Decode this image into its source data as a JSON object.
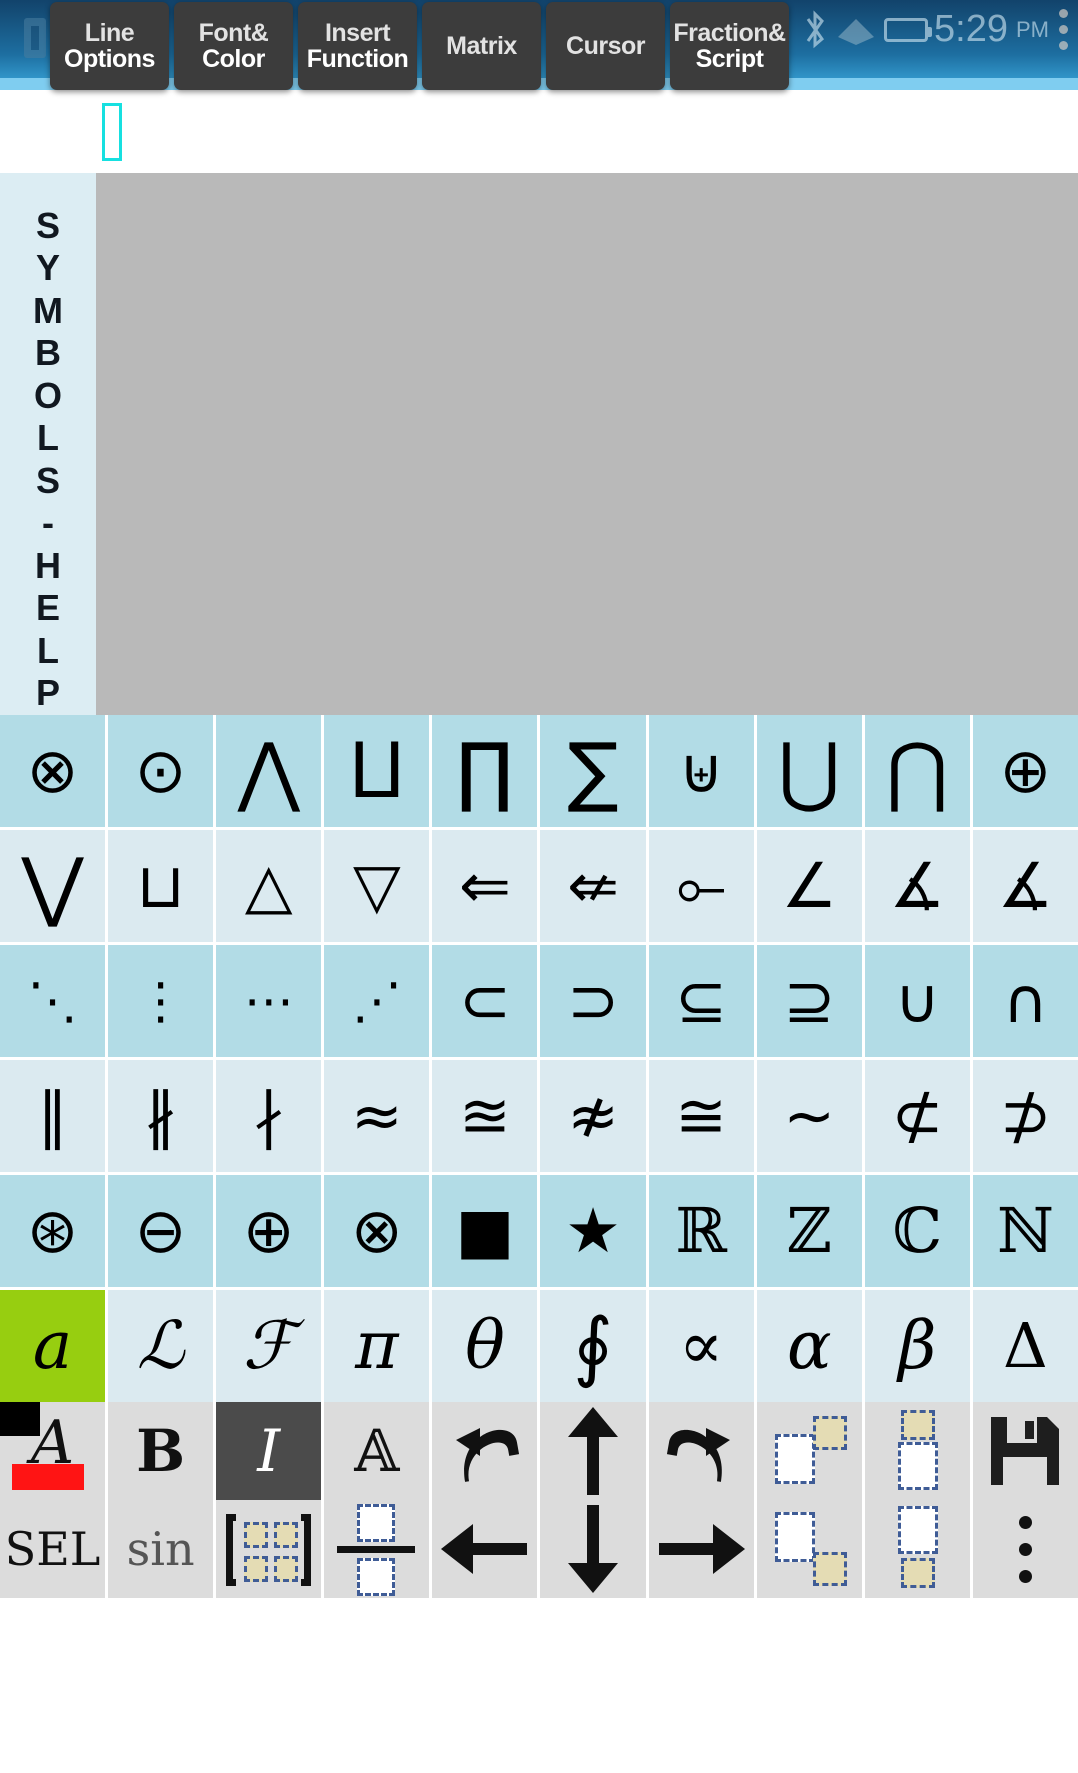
{
  "statusbar": {
    "time": "5:29",
    "ampm": "PM",
    "icons": [
      "sim-card-icon",
      "bluetooth-icon",
      "wifi-icon",
      "battery-icon",
      "overflow-menu-icon"
    ]
  },
  "toolbar": {
    "buttons": [
      {
        "name": "line-options",
        "line1": "Line",
        "line2": "Options"
      },
      {
        "name": "font-color",
        "line1": "Font&",
        "line2": "Color"
      },
      {
        "name": "insert-function",
        "line1": "Insert",
        "line2": "Function"
      },
      {
        "name": "matrix",
        "line1": "Matrix",
        "line2": ""
      },
      {
        "name": "cursor",
        "line1": "Cursor",
        "line2": ""
      },
      {
        "name": "fraction-script",
        "line1": "Fraction&",
        "line2": "Script"
      }
    ]
  },
  "editor": {
    "content": "",
    "caret_visible": true,
    "sidebar_label": "SYMBOLS-HELP",
    "sidebar_letters": [
      "S",
      "Y",
      "M",
      "B",
      "O",
      "L",
      "S",
      "-",
      "H",
      "E",
      "L",
      "P"
    ],
    "canvas_color": "#b9b9b9"
  },
  "colors": {
    "grid_dark": "#b2dce6",
    "grid_light": "#dbeaf0",
    "selected": "#97ce10",
    "toolbar_chip": "#3c3c3c",
    "accent_caret": "#16e0e0",
    "sidebar_bg": "#dcedf3",
    "bottom_key": "#dcdcdc",
    "bottom_key_active": "#4b4b4b"
  },
  "symbol_grid": {
    "columns": 10,
    "selected_index": 50,
    "rows": [
      {
        "shade": "dark",
        "cells": [
          {
            "name": "symbol-circled-times",
            "glyph": "⊗"
          },
          {
            "name": "symbol-circled-dot",
            "glyph": "⊙"
          },
          {
            "name": "symbol-logical-and",
            "glyph": "⋀"
          },
          {
            "name": "symbol-coproduct",
            "glyph": "⨿"
          },
          {
            "name": "symbol-product",
            "glyph": "∏"
          },
          {
            "name": "symbol-summation",
            "glyph": "∑"
          },
          {
            "name": "symbol-multiset-union",
            "glyph": "⊎"
          },
          {
            "name": "symbol-big-union",
            "glyph": "⋃"
          },
          {
            "name": "symbol-big-intersection",
            "glyph": "⋂"
          },
          {
            "name": "symbol-circled-plus",
            "glyph": "⊕"
          }
        ]
      },
      {
        "shade": "light",
        "cells": [
          {
            "name": "symbol-logical-or",
            "glyph": "⋁"
          },
          {
            "name": "symbol-square-cup",
            "glyph": "⊔"
          },
          {
            "name": "symbol-triangle-up",
            "glyph": "△"
          },
          {
            "name": "symbol-triangle-down",
            "glyph": "▽"
          },
          {
            "name": "symbol-leftwards-double-arrow",
            "glyph": "⇐"
          },
          {
            "name": "symbol-leftwards-double-arrow-not",
            "glyph": "⇍"
          },
          {
            "name": "symbol-multimap-left",
            "glyph": "⟜"
          },
          {
            "name": "symbol-angle",
            "glyph": "∠"
          },
          {
            "name": "symbol-measured-angle",
            "glyph": "∡"
          },
          {
            "name": "symbol-measured-angle-2",
            "glyph": "∡"
          }
        ]
      },
      {
        "shade": "dark",
        "cells": [
          {
            "name": "symbol-down-right-diagonal-ellipsis",
            "glyph": "⋱"
          },
          {
            "name": "symbol-vertical-ellipsis",
            "glyph": "⋮"
          },
          {
            "name": "symbol-midline-ellipsis",
            "glyph": "⋯"
          },
          {
            "name": "symbol-up-right-diagonal-ellipsis",
            "glyph": "⋰"
          },
          {
            "name": "symbol-subset",
            "glyph": "⊂"
          },
          {
            "name": "symbol-superset",
            "glyph": "⊃"
          },
          {
            "name": "symbol-subset-or-equal",
            "glyph": "⊆"
          },
          {
            "name": "symbol-superset-or-equal",
            "glyph": "⊇"
          },
          {
            "name": "symbol-union",
            "glyph": "∪"
          },
          {
            "name": "symbol-intersection",
            "glyph": "∩"
          }
        ]
      },
      {
        "shade": "light",
        "cells": [
          {
            "name": "symbol-parallel-to",
            "glyph": "∥"
          },
          {
            "name": "symbol-not-parallel-to",
            "glyph": "∦"
          },
          {
            "name": "symbol-does-not-divide",
            "glyph": "∤"
          },
          {
            "name": "symbol-almost-equal-to",
            "glyph": "≈"
          },
          {
            "name": "symbol-almost-equal-or-equal-to",
            "glyph": "≊"
          },
          {
            "name": "symbol-not-almost-equal-to",
            "glyph": "≉"
          },
          {
            "name": "symbol-approximately-equal-to",
            "glyph": "≅"
          },
          {
            "name": "symbol-tilde-operator",
            "glyph": "∼"
          },
          {
            "name": "symbol-not-subset-of",
            "glyph": "⊄"
          },
          {
            "name": "symbol-not-superset-of",
            "glyph": "⊅"
          }
        ]
      },
      {
        "shade": "dark",
        "cells": [
          {
            "name": "symbol-circled-asterisk",
            "glyph": "⊛"
          },
          {
            "name": "symbol-circled-minus",
            "glyph": "⊖"
          },
          {
            "name": "symbol-circled-plus",
            "glyph": "⊕"
          },
          {
            "name": "symbol-circled-times",
            "glyph": "⊗"
          },
          {
            "name": "symbol-black-square",
            "glyph": "■"
          },
          {
            "name": "symbol-black-star",
            "glyph": "★"
          },
          {
            "name": "symbol-double-struck-r",
            "glyph": "ℝ"
          },
          {
            "name": "symbol-double-struck-z",
            "glyph": "ℤ"
          },
          {
            "name": "symbol-double-struck-c",
            "glyph": "ℂ"
          },
          {
            "name": "symbol-double-struck-n",
            "glyph": "ℕ"
          }
        ]
      },
      {
        "shade": "light",
        "cells": [
          {
            "name": "symbol-italic-a",
            "glyph": "a",
            "selected": true
          },
          {
            "name": "symbol-script-l",
            "glyph": "ℒ"
          },
          {
            "name": "symbol-script-f",
            "glyph": "ℱ"
          },
          {
            "name": "symbol-pi",
            "glyph": "π"
          },
          {
            "name": "symbol-theta",
            "glyph": "θ"
          },
          {
            "name": "symbol-contour-integral",
            "glyph": "∮"
          },
          {
            "name": "symbol-proportional-to",
            "glyph": "∝"
          },
          {
            "name": "symbol-alpha",
            "glyph": "α"
          },
          {
            "name": "symbol-beta",
            "glyph": "β"
          },
          {
            "name": "symbol-increment-delta",
            "glyph": "Δ"
          }
        ]
      }
    ]
  },
  "bottom_toolbar": {
    "row1": [
      {
        "name": "text-color-button",
        "type": "color-a",
        "label": "A"
      },
      {
        "name": "bold-button",
        "type": "text",
        "label": "B"
      },
      {
        "name": "italic-button",
        "type": "text",
        "label": "I",
        "active": true
      },
      {
        "name": "outline-font-button",
        "type": "text",
        "label": "𝔸"
      },
      {
        "name": "undo-button",
        "type": "icon",
        "label": "undo-icon"
      },
      {
        "name": "arrow-up-button",
        "type": "icon",
        "label": "arrow-up-icon"
      },
      {
        "name": "redo-button",
        "type": "icon",
        "label": "redo-icon"
      },
      {
        "name": "subscript-left-button",
        "type": "icon",
        "label": "subscript-placeholder-icon"
      },
      {
        "name": "superscript-stack-button",
        "type": "icon",
        "label": "superscript-stack-icon"
      },
      {
        "name": "save-button",
        "type": "icon",
        "label": "floppy-disk-icon"
      }
    ],
    "row2": [
      {
        "name": "select-button",
        "type": "text",
        "label": "SEL"
      },
      {
        "name": "sin-function-button",
        "type": "text",
        "label": "sin"
      },
      {
        "name": "matrix-button",
        "type": "icon",
        "label": "matrix-placeholder-icon"
      },
      {
        "name": "fraction-button",
        "type": "icon",
        "label": "fraction-placeholder-icon"
      },
      {
        "name": "arrow-left-button",
        "type": "icon",
        "label": "arrow-left-icon"
      },
      {
        "name": "arrow-down-button",
        "type": "icon",
        "label": "arrow-down-icon"
      },
      {
        "name": "arrow-right-button",
        "type": "icon",
        "label": "arrow-right-icon"
      },
      {
        "name": "subscript-right-button",
        "type": "icon",
        "label": "subscript-right-icon"
      },
      {
        "name": "subscript-stack-button",
        "type": "icon",
        "label": "subscript-stack-icon"
      },
      {
        "name": "more-options-button",
        "type": "icon",
        "label": "vertical-dots-icon"
      }
    ]
  }
}
